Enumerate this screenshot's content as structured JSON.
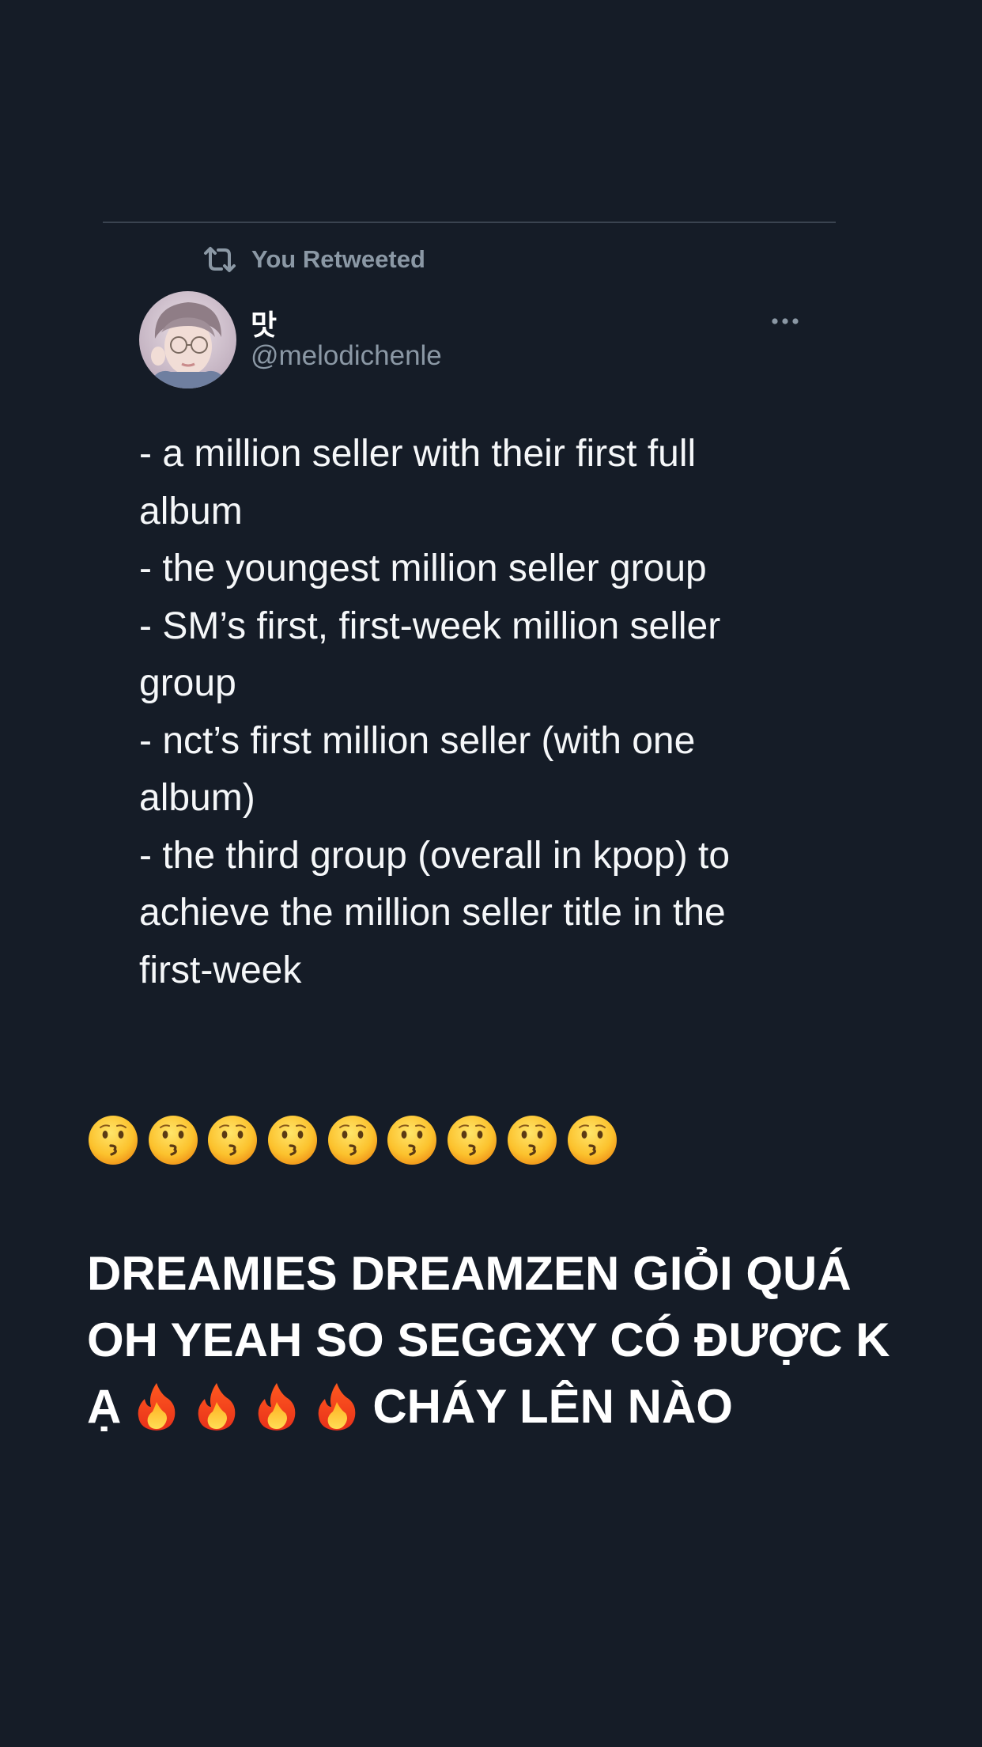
{
  "retweet": {
    "label": "You Retweeted",
    "icon": "retweet-icon"
  },
  "tweet": {
    "display_name": "맛",
    "handle": "@melodichenle",
    "more_icon": "more-options-icon",
    "body_lines": [
      "- a million seller with their first full",
      "album",
      "- the youngest million seller group",
      "- SM’s first, first-week million seller",
      "group",
      "- nct’s first million seller (with one",
      "album)",
      "- the third group (overall in kpop) to",
      "achieve the million seller title in the",
      "first-week"
    ]
  },
  "emoji_row": {
    "emoji": "kissing-face-emoji",
    "count": 9
  },
  "caption": {
    "line1": "DREAMIES DREAMZEN GIỎI QUÁ",
    "line2": "OH YEAH SO SEGGXY CÓ ĐƯỢC K",
    "line3_start": "Ạ",
    "fire_emoji": "fire-emoji",
    "fire_count": 4,
    "line3_end": "CHÁY LÊN NÀO"
  },
  "colors": {
    "background": "#151c27",
    "muted_text": "#8b98a5",
    "divider": "#3a4350",
    "text": "#ffffff"
  }
}
